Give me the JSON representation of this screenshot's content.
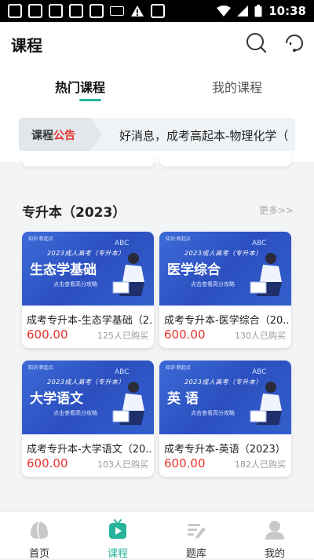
{
  "status_bar": {
    "time": "10:38"
  },
  "header": {
    "title": "课程"
  },
  "tabs": [
    {
      "label": "热门课程"
    },
    {
      "label": "我的课程"
    }
  ],
  "notice": {
    "tag_prefix": "课程",
    "tag_highlight": "公告",
    "text": "好消息，成考高起本-物理化学（"
  },
  "section": {
    "title": "专升本（2023）",
    "more": "更多>>"
  },
  "courses": [
    {
      "image_title": "生态学基础",
      "name": "成考专升本-生态学基础（2...",
      "price": "600.00",
      "buyers": "125人已购买"
    },
    {
      "image_title": "医学综合",
      "name": "成考专升本-医学综合（20...",
      "price": "600.00",
      "buyers": "130人已购买"
    },
    {
      "image_title": "大学语文",
      "name": "成考专升本-大学语文（20...",
      "price": "600.00",
      "buyers": "103人已购买"
    },
    {
      "image_title": "英 语",
      "name": "成考专升本-英语（2023）",
      "price": "600.00",
      "buyers": "182人已购买"
    }
  ],
  "card_banner": {
    "year_line": "2023成人高考（专升本）",
    "cta": "点击查看高分攻略",
    "abc": "ABC"
  },
  "bottom_nav": [
    {
      "label": "首页"
    },
    {
      "label": "课程"
    },
    {
      "label": "题库"
    },
    {
      "label": "我的"
    }
  ],
  "colors": {
    "accent": "#27b49a",
    "price": "#e5322d",
    "banner_blue": "#2c4fbf"
  }
}
